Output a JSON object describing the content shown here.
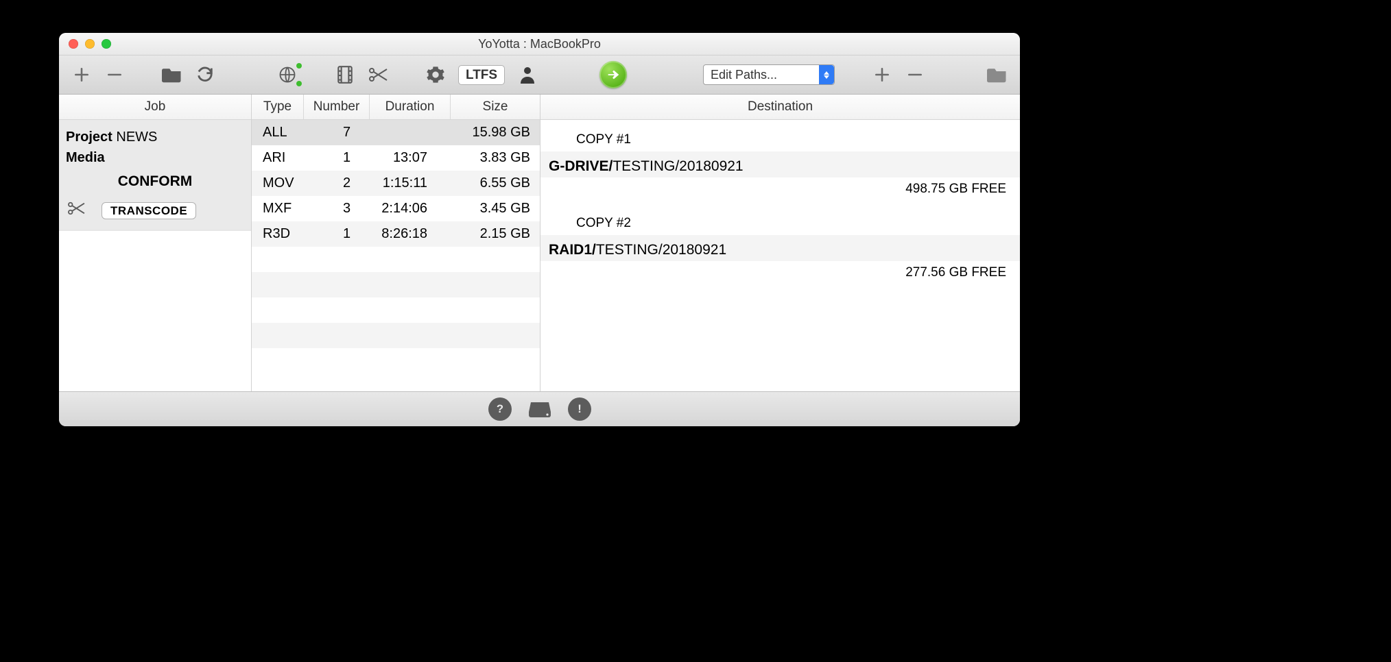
{
  "window": {
    "title": "YoYotta : MacBookPro"
  },
  "toolbar": {
    "ltfs_label": "LTFS",
    "edit_paths_label": "Edit Paths..."
  },
  "job": {
    "header": "Job",
    "project_label": "Project",
    "project_value": "NEWS",
    "media_label": "Media",
    "conform_label": "CONFORM",
    "transcode_label": "TRANSCODE"
  },
  "types": {
    "headers": {
      "type": "Type",
      "number": "Number",
      "duration": "Duration",
      "size": "Size"
    },
    "rows": [
      {
        "type": "ALL",
        "number": "7",
        "duration": "",
        "size": "15.98 GB",
        "selected": true
      },
      {
        "type": "ARI",
        "number": "1",
        "duration": "13:07",
        "size": "3.83 GB",
        "selected": false
      },
      {
        "type": "MOV",
        "number": "2",
        "duration": "1:15:11",
        "size": "6.55 GB",
        "selected": false
      },
      {
        "type": "MXF",
        "number": "3",
        "duration": "2:14:06",
        "size": "3.45 GB",
        "selected": false
      },
      {
        "type": "R3D",
        "number": "1",
        "duration": "8:26:18",
        "size": "2.15 GB",
        "selected": false
      }
    ],
    "blank_rows": 5
  },
  "destination": {
    "header": "Destination",
    "copies": [
      {
        "label": "COPY #1",
        "volume": "G-DRIVE/",
        "path": "TESTING/20180921",
        "free": "498.75 GB FREE"
      },
      {
        "label": "COPY #2",
        "volume": "RAID1/",
        "path": "TESTING/20180921",
        "free": "277.56 GB FREE"
      }
    ]
  }
}
